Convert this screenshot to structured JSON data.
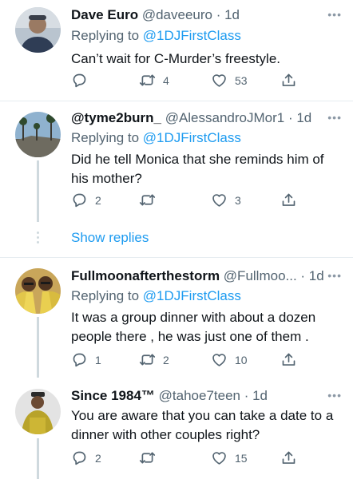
{
  "tweets": [
    {
      "name": "Dave Euro",
      "handle": "@daveeuro",
      "time": "· 1d",
      "replying_label": "Replying to",
      "replying_to": "@1DJFirstClass",
      "text": "Can’t wait for C-Murder’s freestyle.",
      "replies": "",
      "retweets": "4",
      "likes": "53"
    },
    {
      "name": "@tyme2burn_",
      "handle": "@AlessandroJMor1",
      "time": "· 1d",
      "replying_label": "Replying to",
      "replying_to": "@1DJFirstClass",
      "text": "Did he tell Monica that she reminds him of his mother?",
      "replies": "2",
      "retweets": "",
      "likes": "3"
    },
    {
      "name": "Fullmoonafterthestorm",
      "handle": "@Fullmoo...",
      "time": "· 1d",
      "replying_label": "Replying to",
      "replying_to": "@1DJFirstClass",
      "text": "It was a group dinner with about a dozen people there , he was just one of them .",
      "replies": "1",
      "retweets": "2",
      "likes": "10"
    },
    {
      "name": "Since 1984™",
      "handle": "@tahoe7teen",
      "time": "· 1d",
      "replying_label": "",
      "replying_to": "",
      "text": "You are aware that you can take a date to a dinner with other couples right?",
      "replies": "2",
      "retweets": "",
      "likes": "15"
    }
  ],
  "show_replies": "Show replies",
  "icons": {
    "reply": "reply-icon",
    "retweet": "retweet-icon",
    "like": "heart-icon",
    "share": "share-icon",
    "more": "more-options-icon"
  },
  "colors": {
    "link": "#1d9bf0",
    "secondary_text": "#536471",
    "divider": "#e6ecf0"
  }
}
